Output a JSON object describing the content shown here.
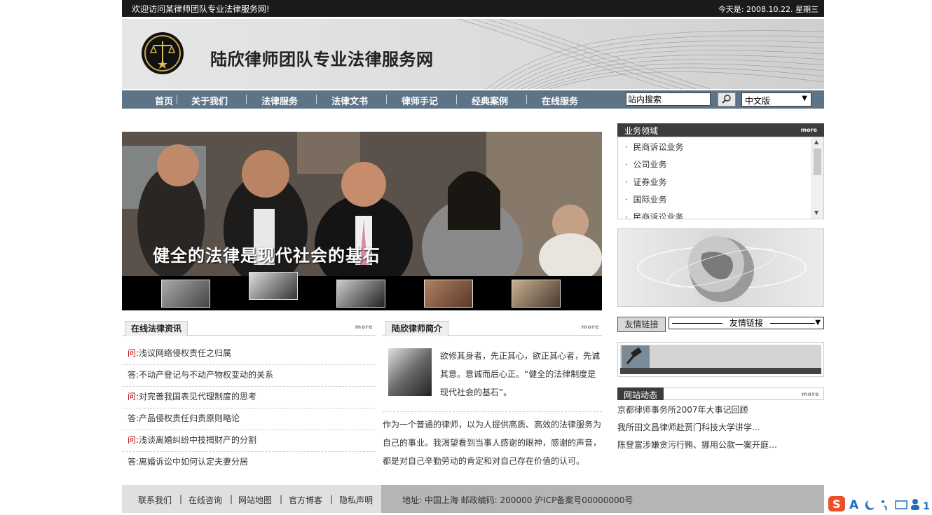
{
  "topbar": {
    "welcome": "欢迎访问某律师团队专业法律服务网!",
    "date": "今天是: 2008.10.22. 星期三"
  },
  "header": {
    "site_title": "陆欣律师团队专业法律服务网"
  },
  "nav": {
    "items": [
      "首页",
      "关于我们",
      "法律服务",
      "法律文书",
      "律师手记",
      "经典案例",
      "在线服务"
    ],
    "search_value": "站内搜索",
    "language": "中文版"
  },
  "banner": {
    "caption": "健全的法律是现代社会的基石"
  },
  "news_box": {
    "title": "在线法律资讯",
    "more": "more",
    "items": [
      {
        "prefix": "问:",
        "text": "浅议网络侵权责任之归属"
      },
      {
        "prefix": "答:",
        "text": "不动产登记与不动产物权变动的关系"
      },
      {
        "prefix": "问:",
        "text": "对完善我国表见代理制度的思考"
      },
      {
        "prefix": "答:",
        "text": "产品侵权责任归责原则略论"
      },
      {
        "prefix": "问:",
        "text": "浅谈离婚纠纷中技揭财产的分割"
      },
      {
        "prefix": "答:",
        "text": "离婚诉讼中如何认定夫妻分居"
      }
    ]
  },
  "intro_box": {
    "title": "陆欣律师简介",
    "more": "more",
    "quote": "欲修其身者，先正其心，欲正其心者，先诚其意。意诚而后心正。“健全的法律制度是 现代社会的基石”。",
    "body": "作为一个普通的律师，以为人提供高质、高效的法律服务为自己的事业。我渴望看到当事人感谢的眼神，感谢的声音，都是对自己辛勤劳动的肯定和对自己存在价值的认可。"
  },
  "business": {
    "title": "业务领域",
    "more": "more",
    "items": [
      "民商诉讼业务",
      "公司业务",
      "证券业务",
      "国际业务",
      "民商诉讼业务"
    ]
  },
  "friend_links": {
    "button": "友情链接",
    "select": "友情链接"
  },
  "site_news": {
    "title": "网站动态",
    "more": "more",
    "items": [
      "京都律师事务所2007年大事记回顾",
      "我所田文昌律师赴贾门科技大学讲学…",
      "陈登富涉嫌贪污行贿、挪用公款一案开庭…"
    ]
  },
  "footer": {
    "links": [
      "联系我们",
      "在线咨询",
      "网站地图",
      "官方博客",
      "隐私声明"
    ],
    "address": "地址: 中国上海  邮政编码: 200000    沪ICP备案号00000000号"
  },
  "colors": {
    "nav": "#5d7388",
    "topbar": "#1b1b1b",
    "section_head": "#3c3c3c",
    "question": "#bb0000"
  }
}
